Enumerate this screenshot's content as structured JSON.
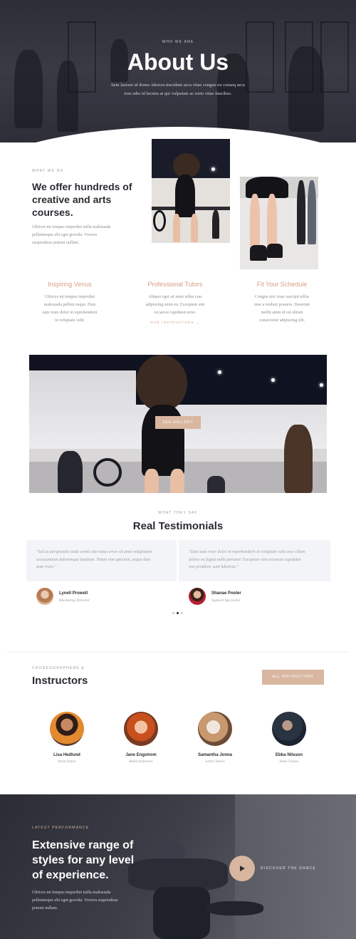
{
  "hero": {
    "eyebrow": "WHO WE ARE",
    "title": "About Us",
    "text_line1": "Sem laoreet id donec ultrices tincidunt arcu vitae congue eu conseq arcu",
    "text_line2": "non odio id lacinia at qui vulputate ac torto vitae faucibus."
  },
  "intro": {
    "eyebrow": "WHAT WE DO",
    "heading_line1": "We offer hundreds of",
    "heading_line2": "creative and arts",
    "heading_line3": "courses.",
    "text_line1": "Ultrices mi tempus imperdiet nulla malesuada",
    "text_line2": "pellentesque elit eget gravida. Viverra",
    "text_line3": "suspendisse potenti nullam."
  },
  "features": [
    {
      "title": "Inspiring Venus",
      "lines": [
        "Ultrices mi tempus imperdiet",
        "malesuada pellent esque. Duis",
        "aute irure dolor in reprehenderit",
        "in voluptate velit."
      ]
    },
    {
      "title": "Professional Tutors",
      "lines": [
        "Aliquet eget sit amet tellus cras",
        "adipiscing enim eu. Excepteur sint",
        "occaecat cupidatat nono."
      ],
      "link": "OUR INSTRUCTORS →"
    },
    {
      "title": "Fit Your Schedule",
      "lines": [
        "Congue nisi vitae suscipit tellus",
        "esse a iordum posuere. Deserunt",
        "mollit anim id est abrum",
        "consectetur adipiscing elit."
      ]
    }
  ],
  "gallery": {
    "button": "SEE GALLERY"
  },
  "testimonials": {
    "eyebrow": "WHAT THEY SAY",
    "title": "Real Testimonials",
    "items": [
      {
        "lines": [
          "\"Sed ut perspiciatis unde omnis iste natus error sit amet voluptatem",
          "accusantium doloremque laudium. Totam rem aperiam, eaque duis",
          "aute irure.\""
        ],
        "name": "Lynell Prowell",
        "role": "Marketing Director"
      },
      {
        "lines": [
          "\"Duis aute irure dolor in reprehenderit in voluptate velit esse cillum",
          "dolore eu fugiat nulla pariatur. Excepteur sint occaecat cupidatat",
          "non proident, sunt laboreas.\""
        ],
        "name": "Shanae Pooler",
        "role": "Support Specialist"
      }
    ]
  },
  "instructors": {
    "eyebrow": "CHOREOGRAPHERS &",
    "title": "Instructors",
    "button": "ALL INSTRUCTORS",
    "items": [
      {
        "name": "Lisa Hedlund",
        "role": "Street Dance"
      },
      {
        "name": "Jane Engstrom",
        "role": "Ballet Instructor"
      },
      {
        "name": "Samantha Jonna",
        "role": "Latin Classes"
      },
      {
        "name": "Ebba Nilsson",
        "role": "Salsa Classes"
      }
    ]
  },
  "performance": {
    "eyebrow": "LATEST PERFORMANCE",
    "heading_line1": "Extensive range of",
    "heading_line2": "styles for any level",
    "heading_line3": "of experience.",
    "text_line1": "Ultrices mi tempus imperdiet nulla malesuada",
    "text_line2": "pellentesque elit eget gravida. Viverra suspendisse",
    "text_line3": "potenti nullam.",
    "video_label": "DISCOVER THE DANCE"
  },
  "colors": {
    "accent": "#d8b69f",
    "accent_text": "#d69f86",
    "dark": "#2b2b33"
  }
}
